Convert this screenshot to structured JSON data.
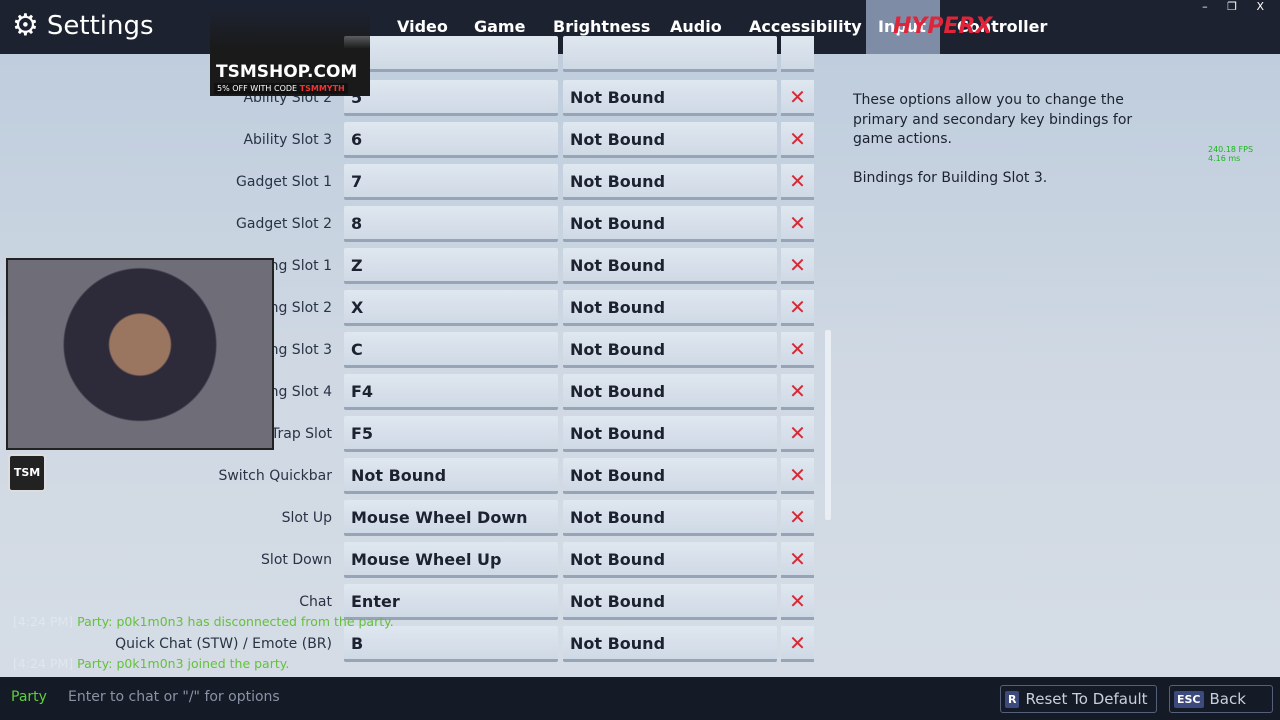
{
  "header": {
    "title": "Settings",
    "tabs": [
      "Video",
      "Game",
      "Brightness",
      "Audio",
      "Accessibility",
      "Input",
      "Controller"
    ],
    "active_tab": "Input"
  },
  "rows": [
    {
      "label": "Ability Slot 2",
      "primary": "5",
      "secondary": "Not Bound"
    },
    {
      "label": "Ability Slot 3",
      "primary": "6",
      "secondary": "Not Bound"
    },
    {
      "label": "Gadget Slot 1",
      "primary": "7",
      "secondary": "Not Bound"
    },
    {
      "label": "Gadget Slot 2",
      "primary": "8",
      "secondary": "Not Bound"
    },
    {
      "label": "Building Slot 1",
      "primary": "Z",
      "secondary": "Not Bound"
    },
    {
      "label": "Building Slot 2",
      "primary": "X",
      "secondary": "Not Bound"
    },
    {
      "label": "Building Slot 3",
      "primary": "C",
      "secondary": "Not Bound"
    },
    {
      "label": "Building Slot 4",
      "primary": "F4",
      "secondary": "Not Bound"
    },
    {
      "label": "Trap Slot",
      "primary": "F5",
      "secondary": "Not Bound"
    },
    {
      "label": "Switch Quickbar",
      "primary": "Not Bound",
      "secondary": "Not Bound"
    },
    {
      "label": "Slot Up",
      "primary": "Mouse Wheel Down",
      "secondary": "Not Bound"
    },
    {
      "label": "Slot Down",
      "primary": "Mouse Wheel Up",
      "secondary": "Not Bound"
    },
    {
      "label": "Chat",
      "primary": "Enter",
      "secondary": "Not Bound"
    },
    {
      "label": "Quick Chat (STW) / Emote (BR)",
      "primary": "B",
      "secondary": "Not Bound"
    }
  ],
  "clear_icon": "x-icon",
  "description": {
    "text": "These options allow you to change the primary and secondary key bindings for game actions.",
    "detail": "Bindings for Building Slot 3."
  },
  "fps": {
    "fps": "240.18 FPS",
    "ms": "4.16 ms"
  },
  "overlay": {
    "shop_url": "TSMSHOP.COM",
    "code_text": "5% OFF WITH CODE ",
    "code": "TSMMYTH",
    "logo": "TSM",
    "sponsor": "HyperX"
  },
  "chat": [
    {
      "time": "[4:24 PM]",
      "text": "Party: p0k1m0n3 has disconnected from the party."
    },
    {
      "time": "[4:24 PM]",
      "text": "Party: p0k1m0n3 joined the party."
    }
  ],
  "footer": {
    "channel": "Party",
    "placeholder": "Enter to chat or \"/\" for options",
    "reset_key": "R",
    "reset_label": "Reset To Default",
    "back_key": "ESC",
    "back_label": "Back"
  },
  "colors": {
    "header": "#1d2230",
    "clear": "#d42a35",
    "chat": "#63c23a"
  }
}
